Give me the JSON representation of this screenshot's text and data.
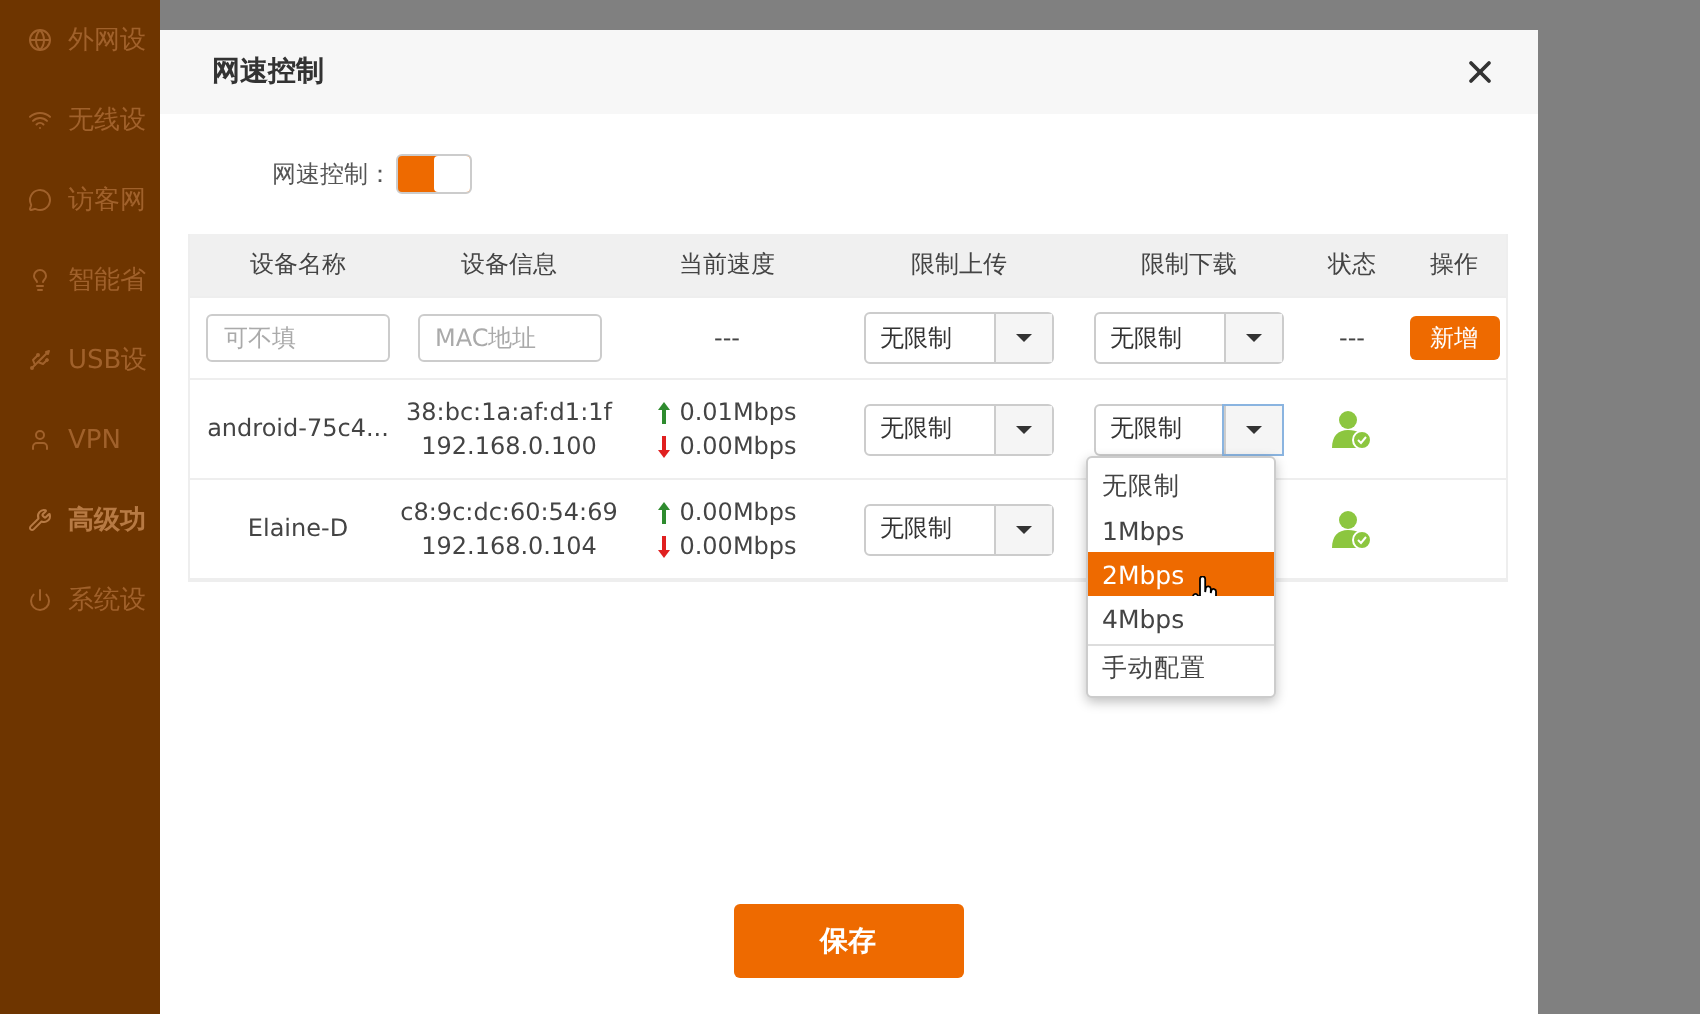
{
  "sidebar": {
    "items": [
      {
        "label": "外网设",
        "selected": false
      },
      {
        "label": "无线设",
        "selected": false
      },
      {
        "label": "访客网",
        "selected": false
      },
      {
        "label": "智能省",
        "selected": false
      },
      {
        "label": "USB设",
        "selected": false
      },
      {
        "label": "VPN",
        "selected": false
      },
      {
        "label": "高级功",
        "selected": true
      },
      {
        "label": "系统设",
        "selected": false
      }
    ]
  },
  "dialog": {
    "title": "网速控制",
    "toggle": {
      "label": "网速控制：",
      "on": true
    },
    "table": {
      "columns": [
        "设备名称",
        "设备信息",
        "当前速度",
        "限制上传",
        "限制下载",
        "状态",
        "操作"
      ],
      "new_row": {
        "name_placeholder": "可不填",
        "mac_placeholder": "MAC地址",
        "speed": "---",
        "upload": "无限制",
        "download": "无限制",
        "status": "---",
        "action": "新增"
      },
      "rows": [
        {
          "name": "android-75c4...",
          "mac": "38:bc:1a:af:d1:1f",
          "ip": "192.168.0.100",
          "up": "0.01Mbps",
          "down": "0.00Mbps",
          "upload": "无限制",
          "download": "无限制",
          "download_open": true
        },
        {
          "name": "Elaine-D",
          "mac": "c8:9c:dc:60:54:69",
          "ip": "192.168.0.104",
          "up": "0.00Mbps",
          "down": "0.00Mbps",
          "upload": "无限制"
        }
      ]
    },
    "dropdown": {
      "options": [
        {
          "label": "无限制",
          "kind": "preset",
          "selected": false
        },
        {
          "label": "1Mbps",
          "kind": "preset",
          "selected": false
        },
        {
          "label": "2Mbps",
          "kind": "preset",
          "selected": true
        },
        {
          "label": "4Mbps",
          "kind": "preset",
          "selected": false
        },
        {
          "label": "手动配置",
          "kind": "manual",
          "selected": false
        }
      ]
    },
    "save": "保存"
  }
}
